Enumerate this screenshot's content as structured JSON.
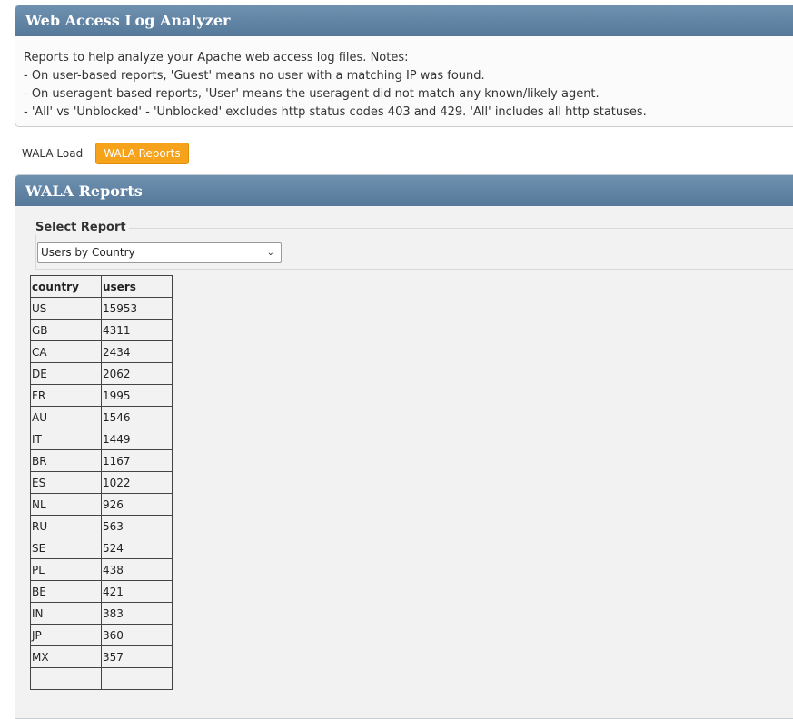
{
  "app": {
    "title": "Web Access Log Analyzer",
    "notes": [
      "Reports to help analyze your Apache web access log files. Notes:",
      "- On user-based reports, 'Guest' means no user with a matching IP was found.",
      "- On useragent-based reports, 'User' means the useragent did not match any known/likely agent.",
      "- 'All' vs 'Unblocked' - 'Unblocked' excludes http status codes 403 and 429. 'All' includes all http statuses."
    ]
  },
  "tabs": [
    {
      "label": "WALA Load",
      "active": false
    },
    {
      "label": "WALA Reports",
      "active": true
    }
  ],
  "reports": {
    "title": "WALA Reports",
    "select_legend": "Select Report",
    "selected_report": "Users by Country",
    "columns": [
      "country",
      "users"
    ],
    "rows": [
      [
        "US",
        "15953"
      ],
      [
        "GB",
        "4311"
      ],
      [
        "CA",
        "2434"
      ],
      [
        "DE",
        "2062"
      ],
      [
        "FR",
        "1995"
      ],
      [
        "AU",
        "1546"
      ],
      [
        "IT",
        "1449"
      ],
      [
        "BR",
        "1167"
      ],
      [
        "ES",
        "1022"
      ],
      [
        "NL",
        "926"
      ],
      [
        "RU",
        "563"
      ],
      [
        "SE",
        "524"
      ],
      [
        "PL",
        "438"
      ],
      [
        "BE",
        "421"
      ],
      [
        "IN",
        "383"
      ],
      [
        "JP",
        "360"
      ],
      [
        "MX",
        "357"
      ],
      [
        "",
        ""
      ]
    ]
  },
  "colors": {
    "header_blue": "#5f82a2",
    "active_tab": "#f6a31b"
  }
}
